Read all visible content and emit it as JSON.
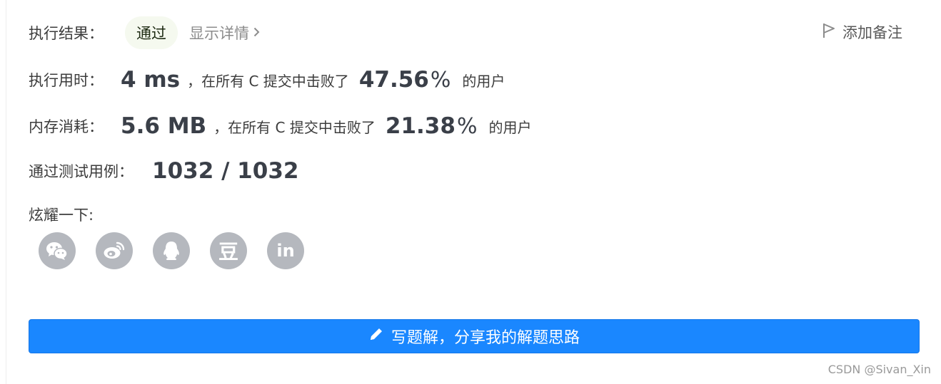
{
  "result": {
    "label": "执行结果：",
    "status": "通过",
    "details_link": "显示详情",
    "add_note": "添加备注"
  },
  "runtime": {
    "label": "执行用时：",
    "value": "4 ms",
    "mid_text": "，在所有 C 提交中击败了",
    "percent": "47.56",
    "percent_sign": "%",
    "suffix": "的用户"
  },
  "memory": {
    "label": "内存消耗：",
    "value": "5.6 MB",
    "mid_text": "，在所有 C 提交中击败了",
    "percent": "21.38",
    "percent_sign": "%",
    "suffix": "的用户"
  },
  "tests": {
    "label": "通过测试用例：",
    "value": "1032 / 1032"
  },
  "share": {
    "label": "炫耀一下:",
    "icons": [
      "wechat-icon",
      "weibo-icon",
      "qq-icon",
      "douban-icon",
      "linkedin-icon"
    ],
    "douban_glyph": "豆",
    "linkedin_glyph": "in"
  },
  "write_solution": {
    "label": "写题解，分享我的解题思路"
  },
  "watermark": "CSDN @Sivan_Xin",
  "colors": {
    "accent_blue": "#1a87ff",
    "icon_gray": "#b5b8be",
    "badge_bg": "#f5f9ef"
  }
}
